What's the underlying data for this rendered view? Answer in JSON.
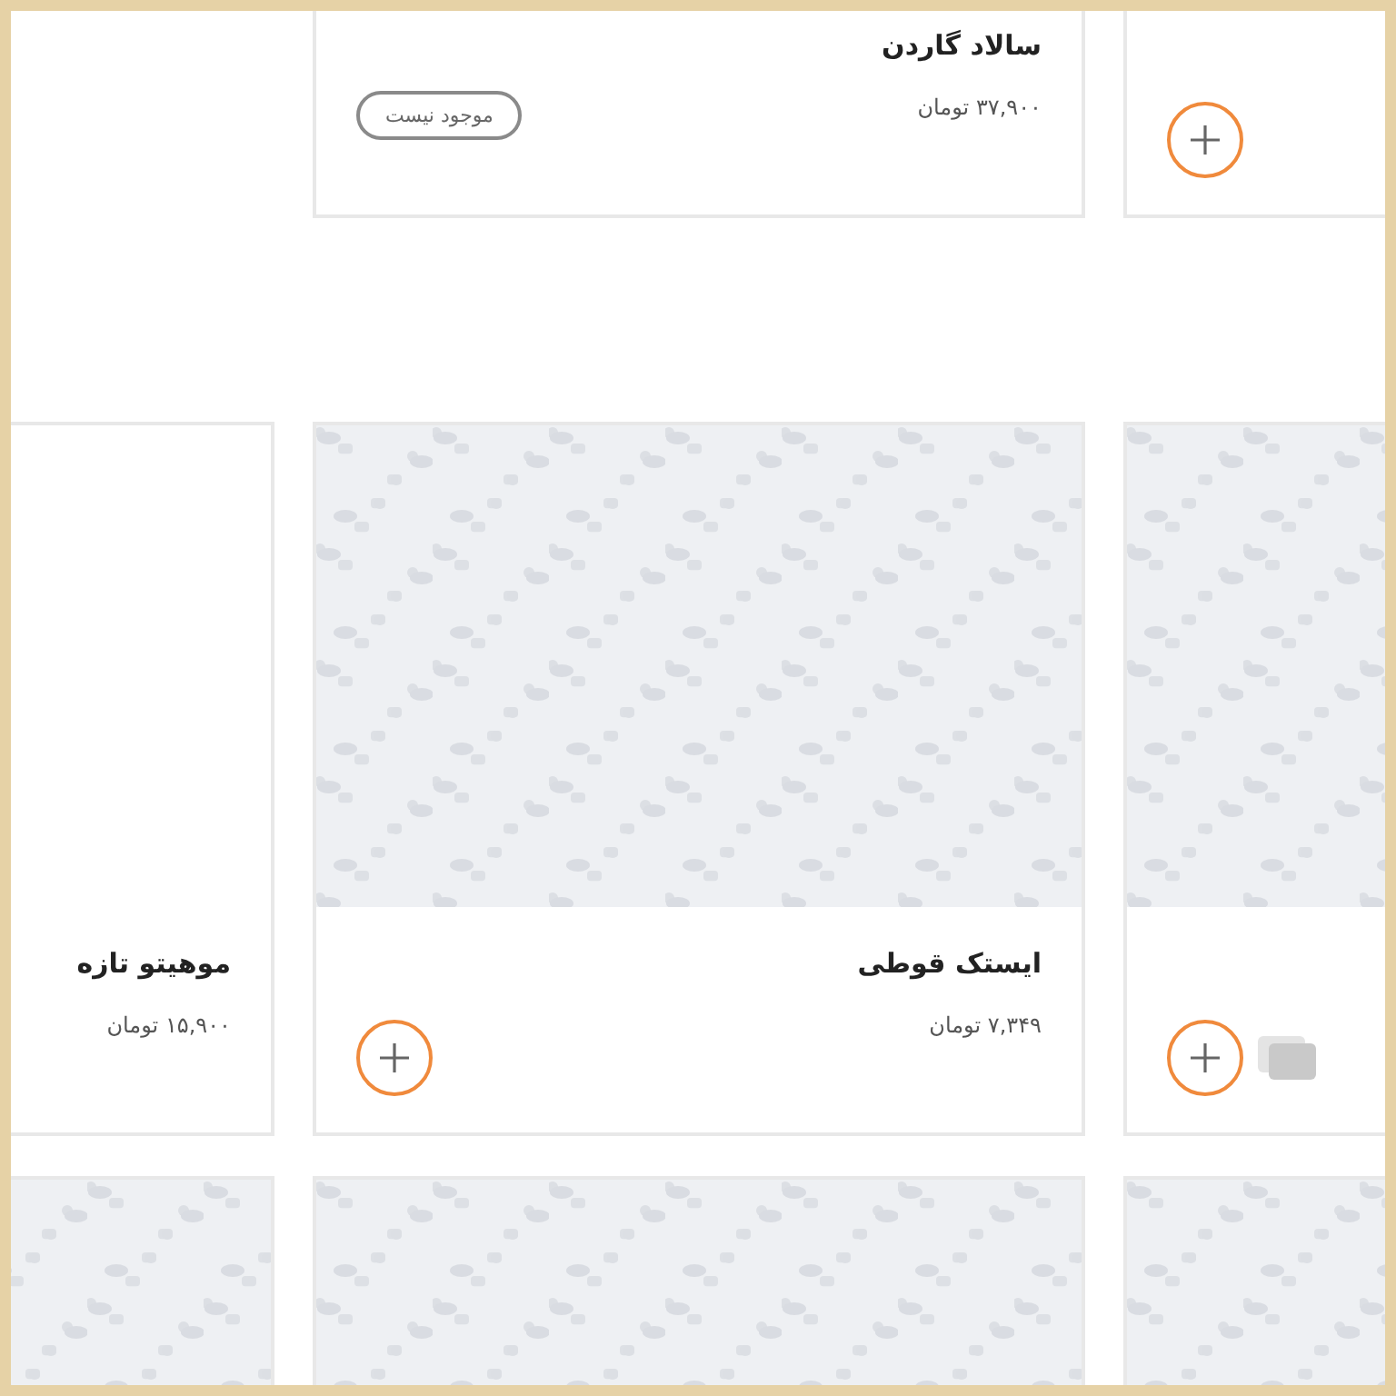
{
  "rows": [
    {
      "cells": [
        {
          "kind": "product",
          "available": true
        },
        {
          "kind": "product",
          "name": "سالاد گاردن",
          "price": "۳۷,۹۰۰ تومان",
          "available": false,
          "status": "موجود نیست"
        },
        {
          "kind": "blank"
        }
      ]
    },
    {
      "cells": [
        {
          "kind": "product",
          "photo": true,
          "available": true,
          "gallery": true
        },
        {
          "kind": "product",
          "photo": true,
          "name": "ایستک قوطی",
          "price": "۷,۳۴۹ تومان",
          "available": true
        },
        {
          "kind": "product",
          "photo": false,
          "name": "موهیتو تازه",
          "price": "۱۵,۹۰۰ تومان"
        }
      ]
    },
    {
      "cells": [
        {
          "kind": "product",
          "photo": true
        },
        {
          "kind": "product",
          "photo": true
        },
        {
          "kind": "product",
          "photo": true
        }
      ]
    }
  ]
}
